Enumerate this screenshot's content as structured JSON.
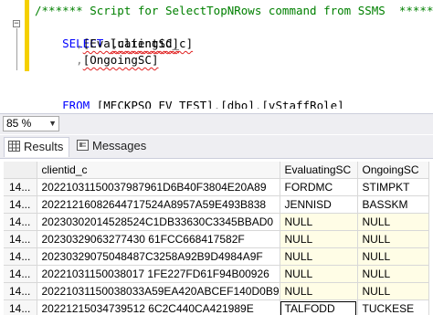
{
  "editor": {
    "line1": "/****** Script for SelectTopNRows command from SSMS  ******/",
    "line2_kw": "SELECT",
    "line2_col": "[clientid_c]",
    "line3_comma": ",",
    "line3_col": "[EvaluatingSC]",
    "line4_comma": ",",
    "line4_col": "[OngoingSC]",
    "line6_kw": "FROM",
    "line6_db": "[MECKPSO_EV_TEST]",
    "line6_dot1": ".",
    "line6_schema": "[dbo]",
    "line6_dot2": ".",
    "line6_view": "[vStaffRole]"
  },
  "zoom": {
    "value": "85 %"
  },
  "tabs": {
    "results": "Results",
    "messages": "Messages"
  },
  "grid": {
    "columns": [
      "clientid_c",
      "EvaluatingSC",
      "OngoingSC"
    ],
    "rows": [
      {
        "num": "14...",
        "clientid_c": "20221031150037987961D6B40F3804E20A89",
        "evaluating": "FORDMC",
        "ongoing": "STIMPKT"
      },
      {
        "num": "14...",
        "clientid_c": "20221216082644717524A8957A59E493B838",
        "evaluating": "JENNISD",
        "ongoing": "BASSKM"
      },
      {
        "num": "14...",
        "clientid_c": "20230302014528524C1DB33630C3345BBAD0",
        "evaluating": "NULL",
        "ongoing": "NULL"
      },
      {
        "num": "14...",
        "clientid_c": "20230329063277430 61FCC668417582F",
        "evaluating": "NULL",
        "ongoing": "NULL"
      },
      {
        "num": "14...",
        "clientid_c": "20230329075048487C3258A92B9D4984A9F",
        "evaluating": "NULL",
        "ongoing": "NULL"
      },
      {
        "num": "14...",
        "clientid_c": "20221031150038017 1FE227FD61F94B00926",
        "evaluating": "NULL",
        "ongoing": "NULL"
      },
      {
        "num": "14...",
        "clientid_c": "20221031150038033A59EA420ABCEF140D0B9",
        "evaluating": "NULL",
        "ongoing": "NULL"
      },
      {
        "num": "14...",
        "clientid_c": "20221215034739512 6C2C440CA421989E",
        "evaluating": "TALFODD",
        "ongoing": "TUCKESE"
      }
    ]
  }
}
